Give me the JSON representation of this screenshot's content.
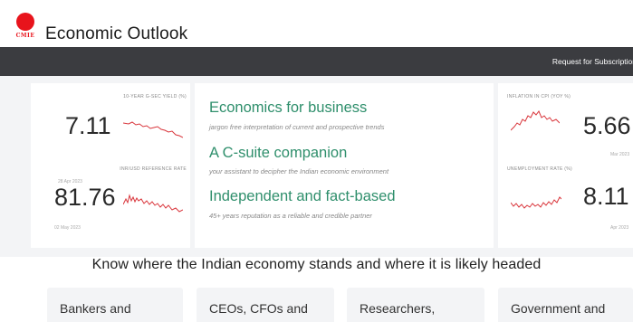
{
  "brand": {
    "logo_text": "CMIE",
    "title": "Economic Outlook",
    "accent_color": "#e8141c"
  },
  "navbar": {
    "subscription_link": "Request for Subscription",
    "background": "#3b3c40"
  },
  "metrics_left": [
    {
      "label": "10-YEAR G-SEC YIELD (%)",
      "value": "7.11",
      "date": "28 Apr 2023",
      "spark_color": "#d9353b"
    },
    {
      "label": "INR/USD REFERENCE RATE",
      "value": "81.76",
      "date": "02 May 2023",
      "spark_color": "#d9353b"
    }
  ],
  "metrics_right": [
    {
      "label": "INFLATION IN CPI (YOY %)",
      "value": "5.66",
      "date": "Mar 2023",
      "spark_color": "#d9353b"
    },
    {
      "label": "UNEMPLOYMENT RATE (%)",
      "value": "8.11",
      "date": "Apr 2023",
      "spark_color": "#d9353b"
    }
  ],
  "taglines": [
    {
      "title": "Economics for business",
      "subtitle": "jargon free interpretation of current and prospective trends"
    },
    {
      "title": "A C-suite companion",
      "subtitle": "your assistant to decipher the Indian economic environment"
    },
    {
      "title": "Independent and fact-based",
      "subtitle": "45+ years reputation as a reliable and credible partner"
    }
  ],
  "headline": "Know where the Indian economy stands and where it is likely headed",
  "audience_cards": [
    {
      "label": "Bankers and"
    },
    {
      "label": "CEOs, CFOs and"
    },
    {
      "label": "Researchers,"
    },
    {
      "label": "Government and"
    }
  ]
}
